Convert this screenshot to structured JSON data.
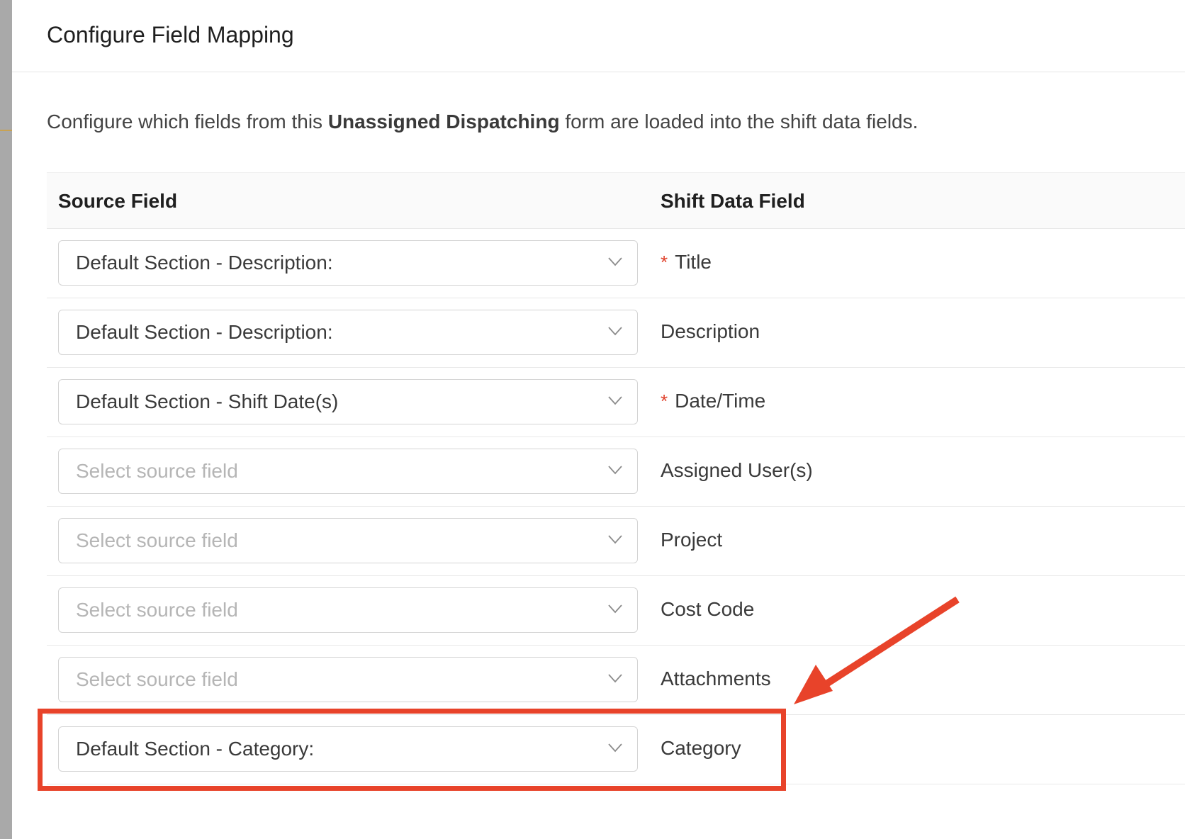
{
  "modal": {
    "title": "Configure Field Mapping"
  },
  "description": {
    "prefix": "Configure which fields from this ",
    "form_name": "Unassigned Dispatching",
    "suffix": " form are loaded into the shift data fields."
  },
  "table": {
    "headers": {
      "source": "Source Field",
      "target": "Shift Data Field"
    },
    "rows": [
      {
        "source_value": "Default Section - Description:",
        "is_placeholder": false,
        "target_label": "Title",
        "required": true
      },
      {
        "source_value": "Default Section - Description:",
        "is_placeholder": false,
        "target_label": "Description",
        "required": false
      },
      {
        "source_value": "Default Section - Shift Date(s)",
        "is_placeholder": false,
        "target_label": "Date/Time",
        "required": true
      },
      {
        "source_value": "Select source field",
        "is_placeholder": true,
        "target_label": "Assigned User(s)",
        "required": false
      },
      {
        "source_value": "Select source field",
        "is_placeholder": true,
        "target_label": "Project",
        "required": false
      },
      {
        "source_value": "Select source field",
        "is_placeholder": true,
        "target_label": "Cost Code",
        "required": false
      },
      {
        "source_value": "Select source field",
        "is_placeholder": true,
        "target_label": "Attachments",
        "required": false
      },
      {
        "source_value": "Default Section - Category:",
        "is_placeholder": false,
        "target_label": "Category",
        "required": false
      }
    ],
    "required_marker": "*"
  },
  "annotation": {
    "color": "#e8432a",
    "highlighted_row": "Category"
  },
  "icons": {
    "select_chevron": "chevron-down-icon"
  }
}
